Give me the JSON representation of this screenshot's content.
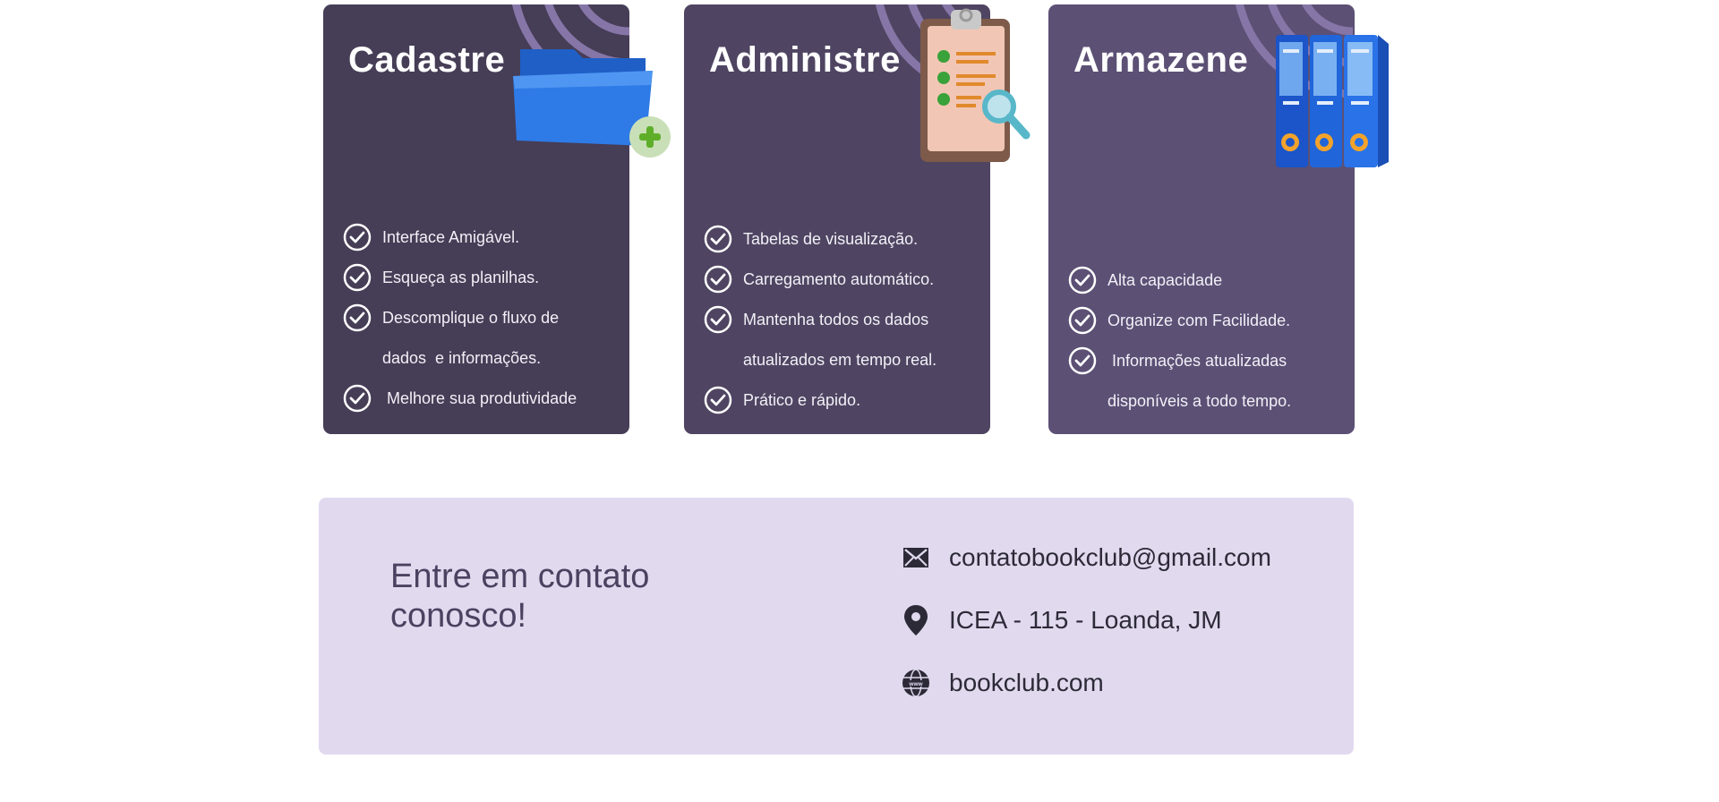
{
  "cards": [
    {
      "title": "Cadastre",
      "illustration": "folder-add-icon",
      "features": [
        "Interface Amigável.",
        "Esqueça as planilhas.",
        "Descomplique o fluxo de dados  e informações.",
        " Melhore sua produtividade"
      ]
    },
    {
      "title": "Administre",
      "illustration": "clipboard-search-icon",
      "features": [
        "Tabelas de visualização.",
        "Carregamento automático.",
        "Mantenha todos os dados atualizados em tempo real.",
        "Prático e rápido."
      ]
    },
    {
      "title": "Armazene",
      "illustration": "binders-icon",
      "features": [
        "Alta capacidade",
        "Organize com Facilidade.",
        " Informações atualizadas disponíveis a todo tempo."
      ]
    }
  ],
  "contact": {
    "heading": "Entre em contato conosco!",
    "email": "contatobookclub@gmail.com",
    "address": "ICEA - 115 - Loanda, JM",
    "website": "bookclub.com"
  },
  "colors": {
    "card1": "#463d56",
    "card2": "#4f4562",
    "card3": "#5c5075",
    "contact_bg": "#e1daef",
    "arc": "#8676a8"
  }
}
